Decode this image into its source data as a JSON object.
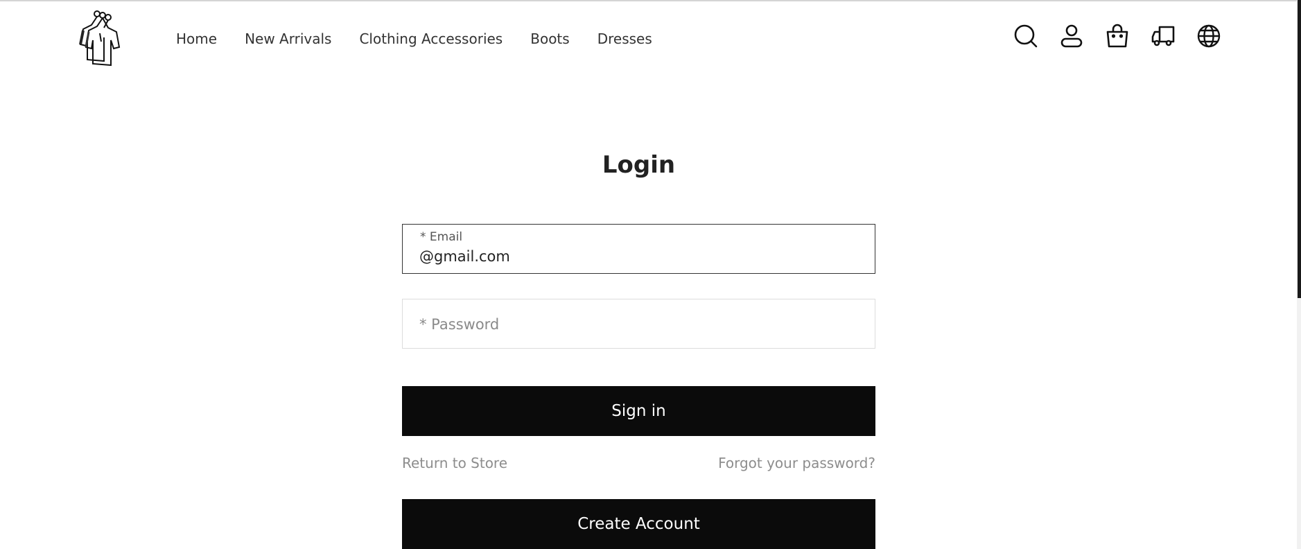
{
  "header": {
    "logo_icon": "clothes-rack-logo-icon",
    "nav": [
      "Home",
      "New Arrivals",
      "Clothing Accessories",
      "Boots",
      "Dresses"
    ],
    "icons": [
      "search-icon",
      "user-icon",
      "shopping-bag-icon",
      "delivery-truck-icon",
      "globe-icon"
    ]
  },
  "login": {
    "title": "Login",
    "email_label": "* Email",
    "email_value": "@gmail.com",
    "password_placeholder": "* Password",
    "signin_label": "Sign in",
    "return_link": "Return to Store",
    "forgot_link": "Forgot your password?",
    "create_label": "Create Account"
  },
  "colors": {
    "button": "#0b0b0b",
    "link": "#8d8d8d",
    "text": "#222222"
  }
}
